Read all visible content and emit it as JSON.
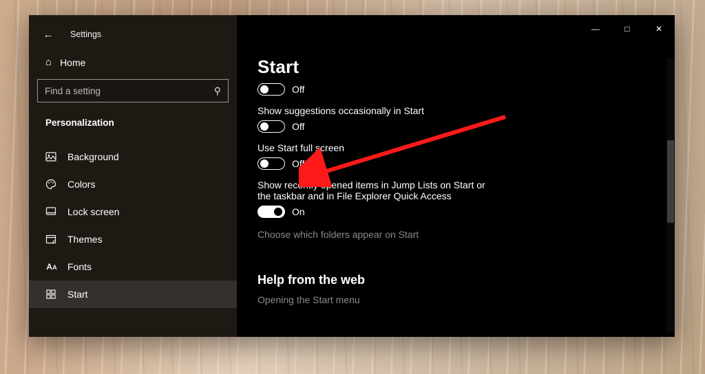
{
  "app": {
    "title": "Settings"
  },
  "sidebar": {
    "home": "Home",
    "search_placeholder": "Find a setting",
    "section": "Personalization",
    "items": [
      {
        "label": "Background"
      },
      {
        "label": "Colors"
      },
      {
        "label": "Lock screen"
      },
      {
        "label": "Themes"
      },
      {
        "label": "Fonts"
      },
      {
        "label": "Start"
      }
    ]
  },
  "page": {
    "title": "Start",
    "settings": [
      {
        "label": "",
        "state": "Off",
        "on": false,
        "partial": true
      },
      {
        "label": "Show suggestions occasionally in Start",
        "state": "Off",
        "on": false
      },
      {
        "label": "Use Start full screen",
        "state": "Off",
        "on": false
      },
      {
        "label": "Show recently opened items in Jump Lists on Start or the taskbar and in File Explorer Quick Access",
        "state": "On",
        "on": true
      }
    ],
    "link_choose_folders": "Choose which folders appear on Start",
    "help_heading": "Help from the web",
    "help_links": [
      "Opening the Start menu"
    ]
  }
}
